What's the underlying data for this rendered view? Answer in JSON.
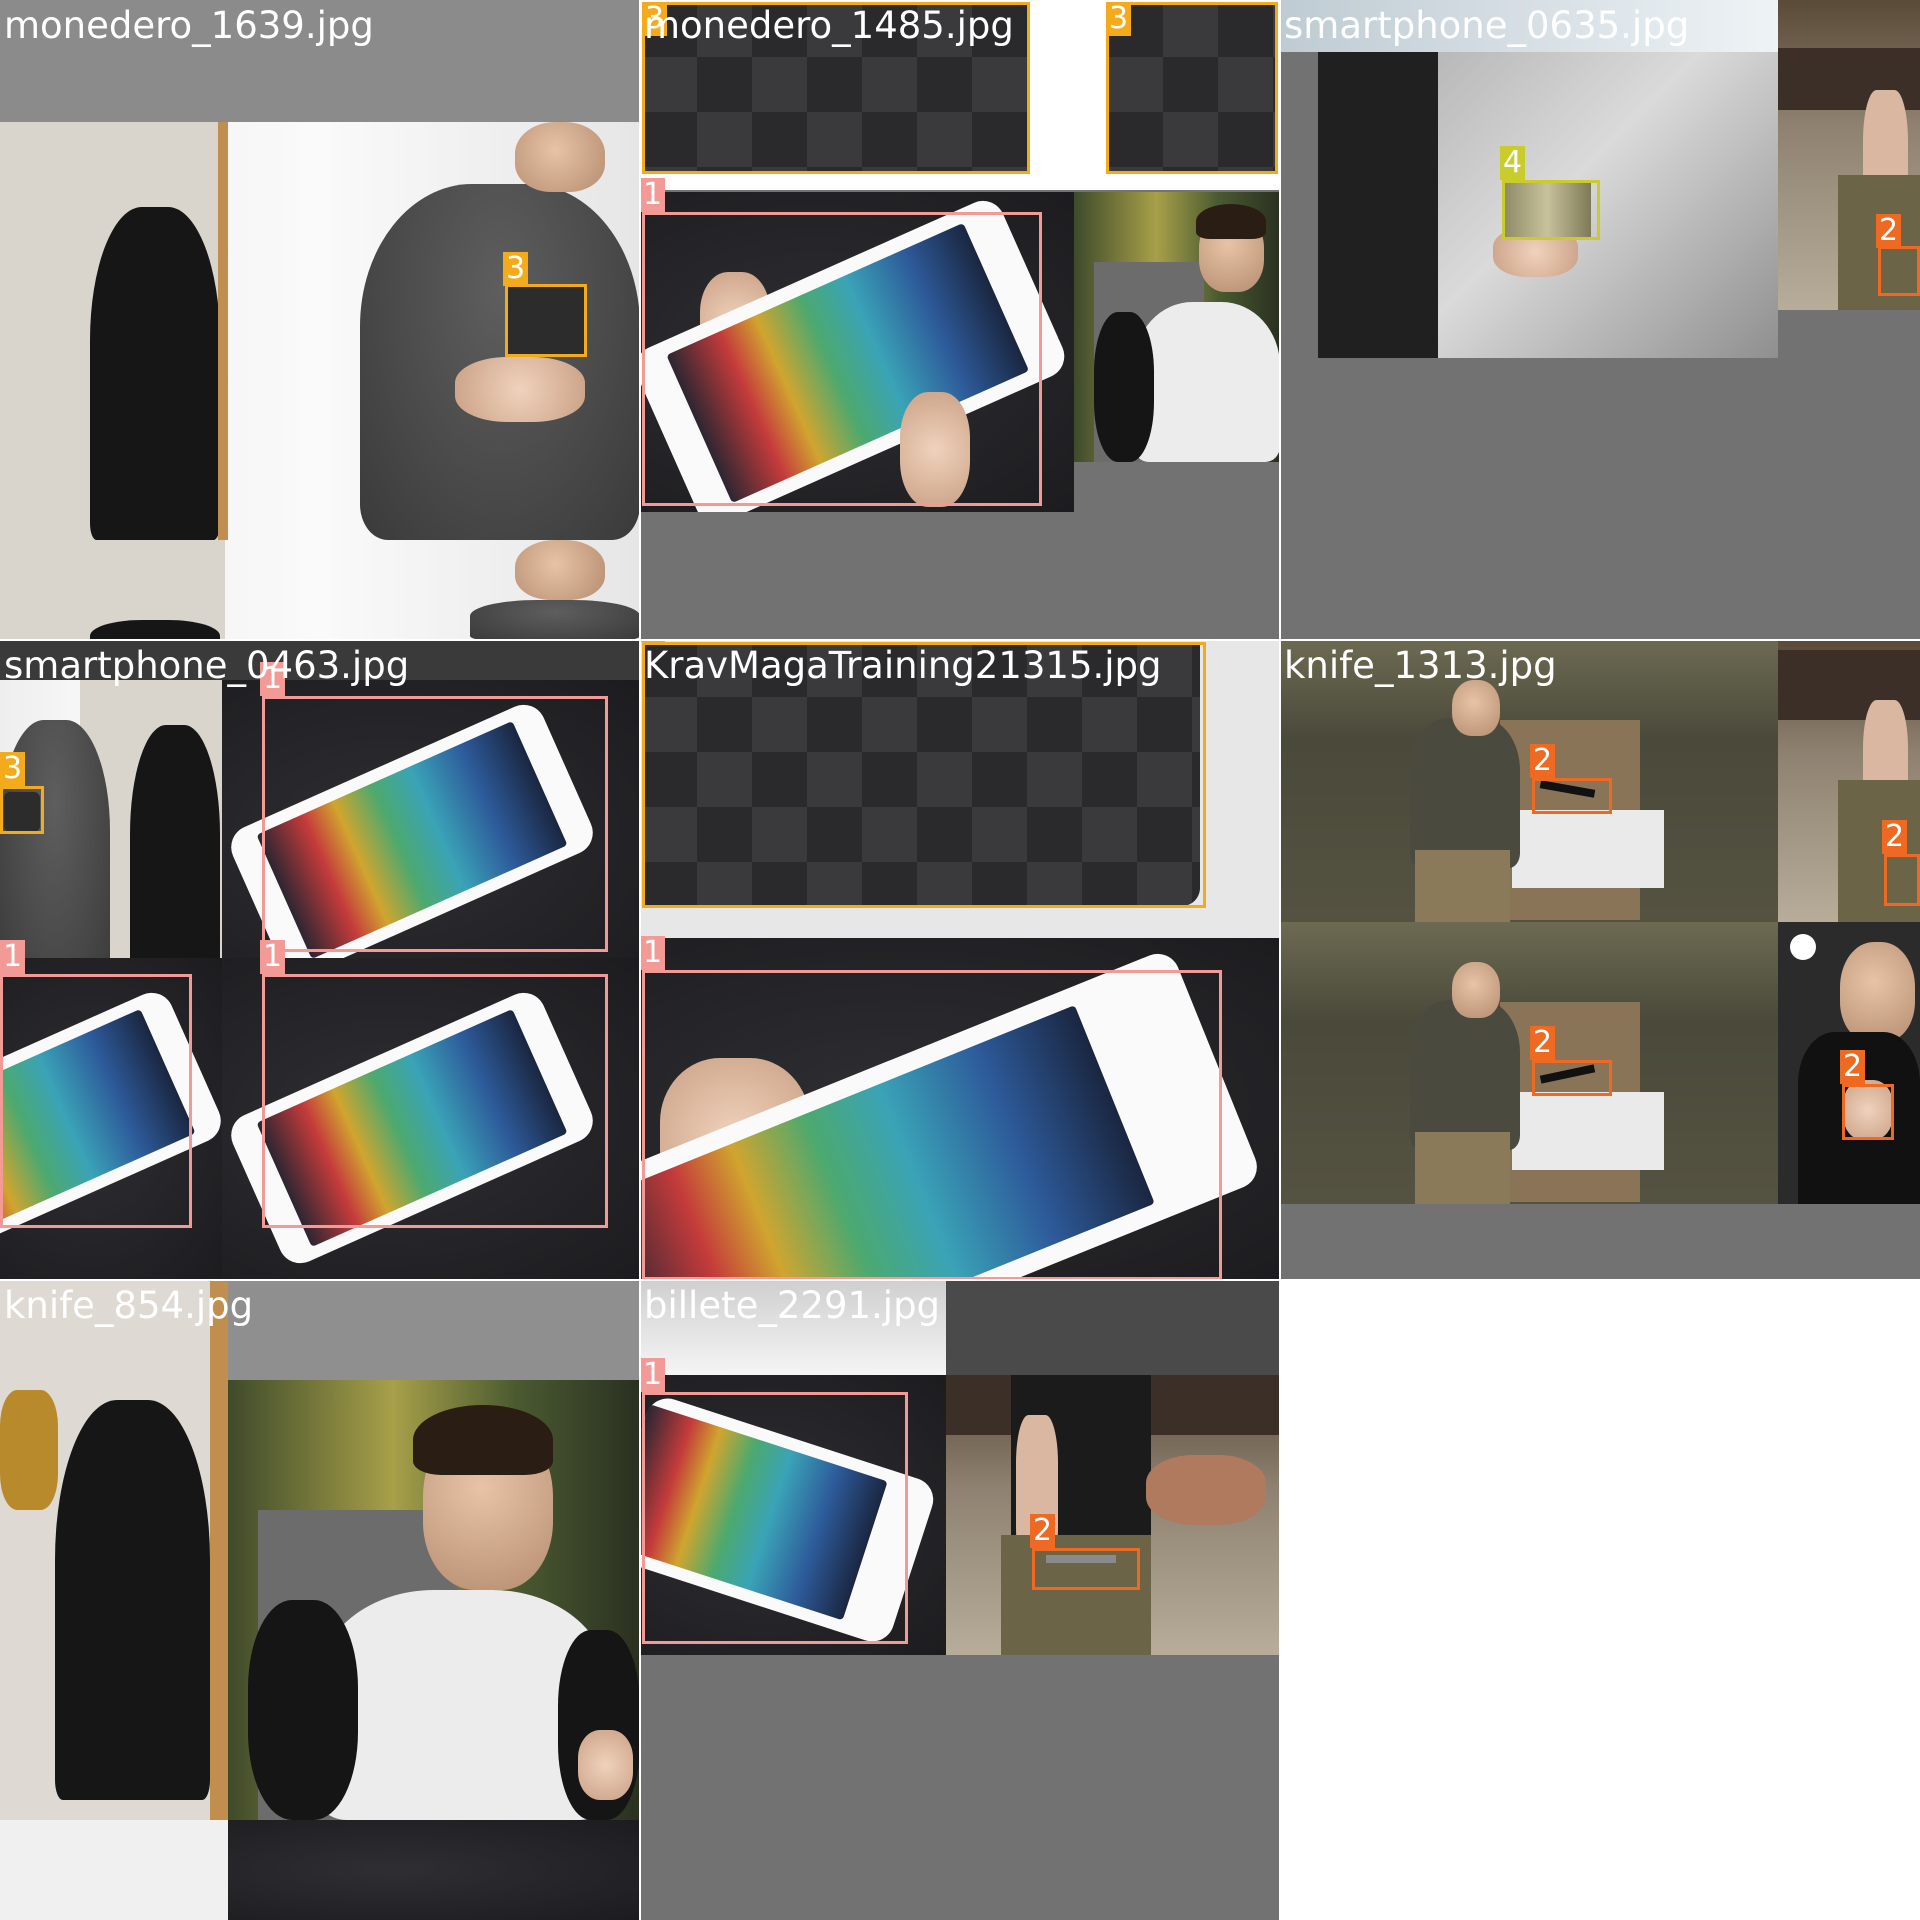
{
  "colors": {
    "class_1": "#f39a97",
    "class_2": "#ee6a22",
    "class_3": "#f3ab1b",
    "class_4": "#c9cc2a",
    "tile_bg": "#727272"
  },
  "tiles": [
    {
      "filename": "monedero_1639.jpg",
      "labels": [
        "3"
      ]
    },
    {
      "filename": "monedero_1485.jpg",
      "labels": [
        "3",
        "3",
        "1"
      ]
    },
    {
      "filename": "smartphone_0635.jpg",
      "labels": [
        "4",
        "2"
      ]
    },
    {
      "filename": "smartphone_0463.jpg",
      "labels": [
        "1",
        "3",
        "1",
        "1"
      ]
    },
    {
      "filename": "KravMagaTraining21315.jpg",
      "labels": [
        "3",
        "1"
      ]
    },
    {
      "filename": "knife_1313.jpg",
      "labels": [
        "2",
        "2",
        "2",
        "2"
      ]
    },
    {
      "filename": "knife_854.jpg",
      "labels": []
    },
    {
      "filename": "billete_2291.jpg",
      "labels": [
        "1",
        "2"
      ]
    }
  ]
}
